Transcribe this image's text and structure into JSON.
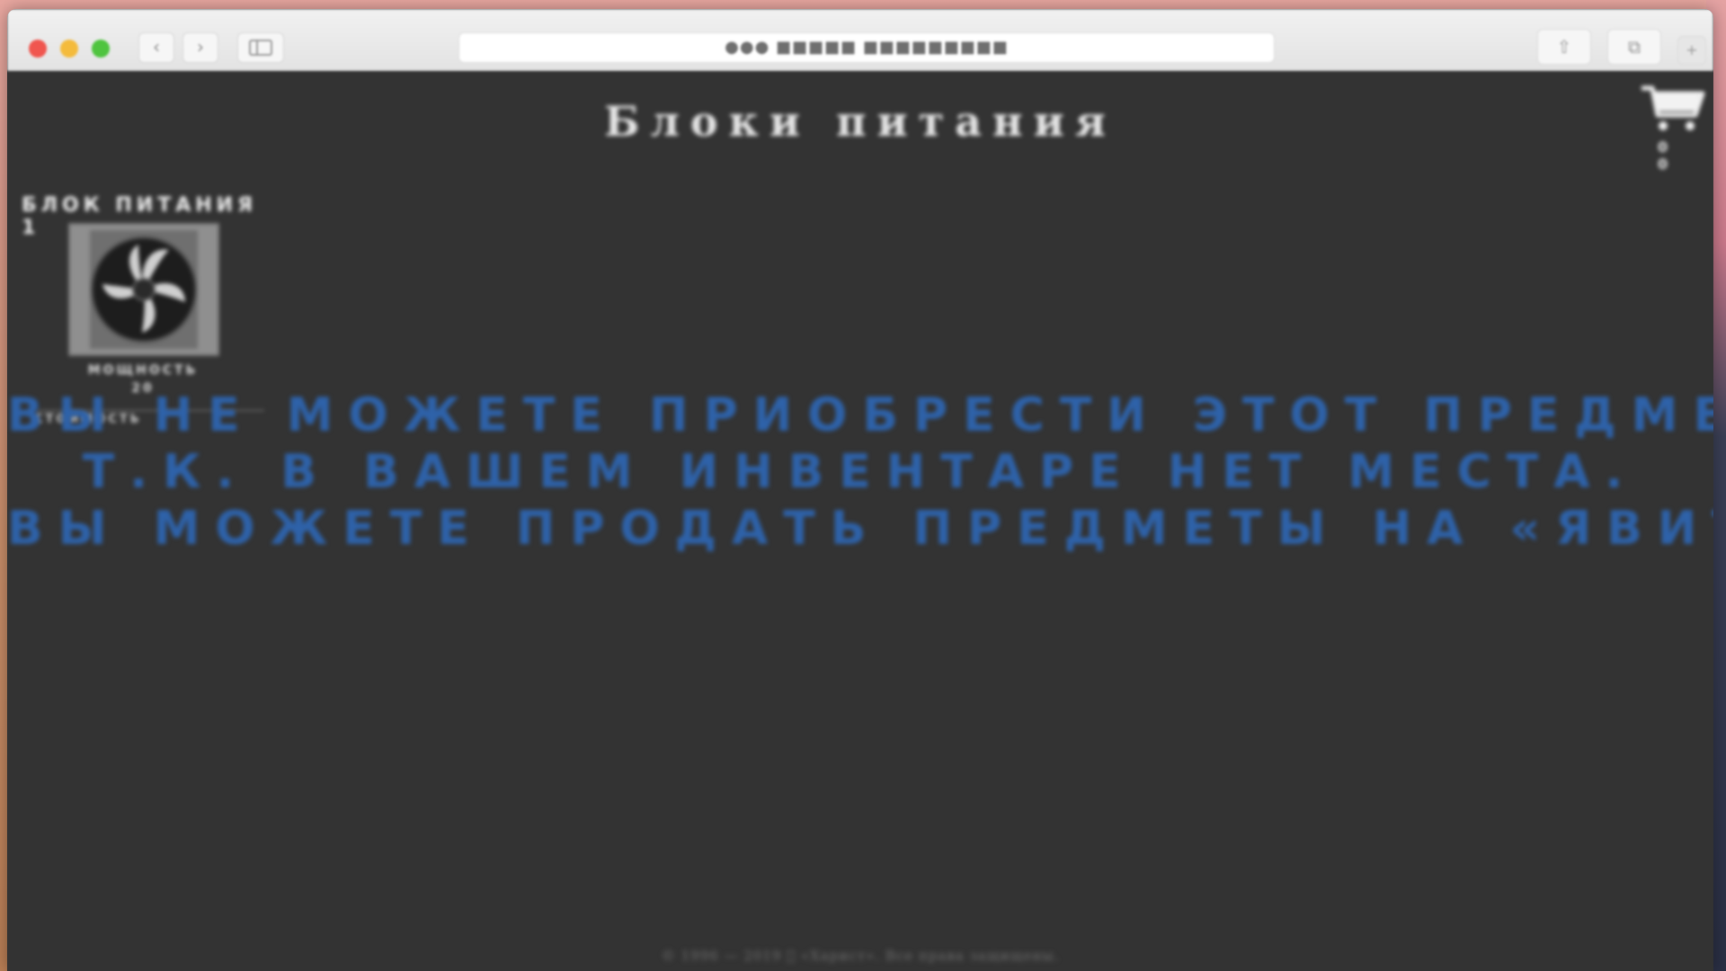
{
  "browser": {
    "url": "●●● ■■■■■ ■■■■■■■■■",
    "back_glyph": "‹",
    "forward_glyph": "›",
    "share_glyph": "⇧",
    "tabs_glyph": "⧉",
    "new_tab_glyph": "+"
  },
  "page": {
    "title": "Блоки питания",
    "cart_count": "0 0"
  },
  "product": {
    "name": "БЛОК ПИТАНИЯ 1",
    "spec_line1": "МОЩНОСТЬ",
    "spec_line2": "20",
    "price_line": "СТОИМОСТЬ"
  },
  "message": {
    "line1": "ВЫ НЕ МОЖЕТЕ ПРИОБРЕСТИ ЭТОТ ПРЕДМЕТ",
    "line2": "Т.К. В ВАШЕМ ИНВЕНТАРЕ НЕТ МЕСТА.",
    "line3": "ВЫ МОЖЕТЕ ПРОДАТЬ ПРЕДМЕТЫ НА «ЯВИТЯ»",
    "color": "#2e62a9"
  },
  "footer": {
    "text": "© 1996 — 2019 \u0000 «Харист». Все права защищены."
  }
}
